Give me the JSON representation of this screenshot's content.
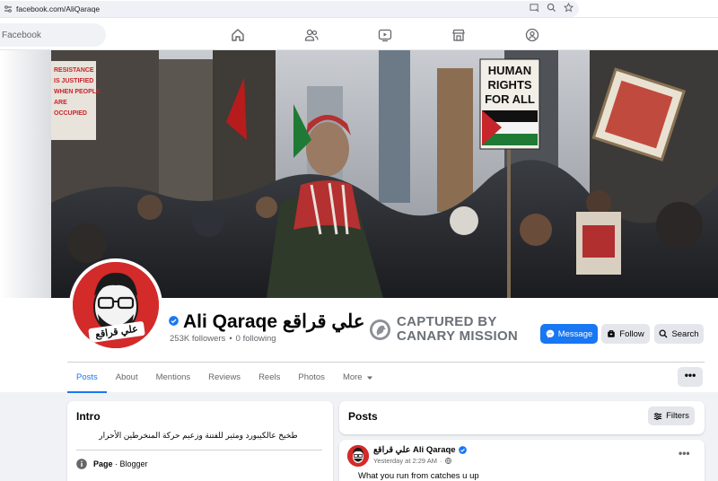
{
  "browser": {
    "url": "facebook.com/AliQaraqe",
    "tool_icons": [
      "install-app-icon",
      "zoom-icon",
      "bookmark-star-icon"
    ]
  },
  "fbnav": {
    "search_placeholder": "Facebook",
    "icons": [
      "home-icon",
      "friends-icon",
      "video-icon",
      "marketplace-icon",
      "groups-icon"
    ]
  },
  "cover": {
    "sign": [
      "HUMAN",
      "RIGHTS",
      "FOR ALL"
    ],
    "left_sign": [
      "RESISTANCE",
      "IS JUSTIFIED",
      "WHEN PEOPLE",
      "ARE",
      "OCCUPIED"
    ]
  },
  "profile": {
    "name": "Ali Qaraqe علي قراقع",
    "avatar_label": "علي قراقع",
    "followers": "253K followers",
    "separator": "•",
    "following": "0 following",
    "verified": true
  },
  "watermark": {
    "line1": "CAPTURED BY",
    "line2": "CANARY MISSION"
  },
  "actions": {
    "message": "Message",
    "follow": "Follow",
    "search": "Search"
  },
  "tabs": [
    {
      "label": "Posts",
      "active": true
    },
    {
      "label": "About",
      "active": false
    },
    {
      "label": "Mentions",
      "active": false
    },
    {
      "label": "Reviews",
      "active": false
    },
    {
      "label": "Reels",
      "active": false
    },
    {
      "label": "Photos",
      "active": false
    },
    {
      "label": "More",
      "active": false
    }
  ],
  "more_menu_label": "•••",
  "intro": {
    "title": "Intro",
    "bio": "طخيخ عالكيبورد ومثير للفتنة وزعيم حركة المنخرطين الأحرار",
    "category_label": "Page",
    "category_value": " · Blogger"
  },
  "posts": {
    "title": "Posts",
    "filters_label": "Filters",
    "items": [
      {
        "author": "علي قراقع Ali Qaraqe",
        "time": "Yesterday at 2:29 AM",
        "time_separator": "·",
        "menu": "•••",
        "text": "What you run from catches u up"
      }
    ]
  },
  "colors": {
    "facebook_blue": "#1877f2",
    "avatar_red": "#d32a2a",
    "watermark_gray": "#6b7077"
  }
}
